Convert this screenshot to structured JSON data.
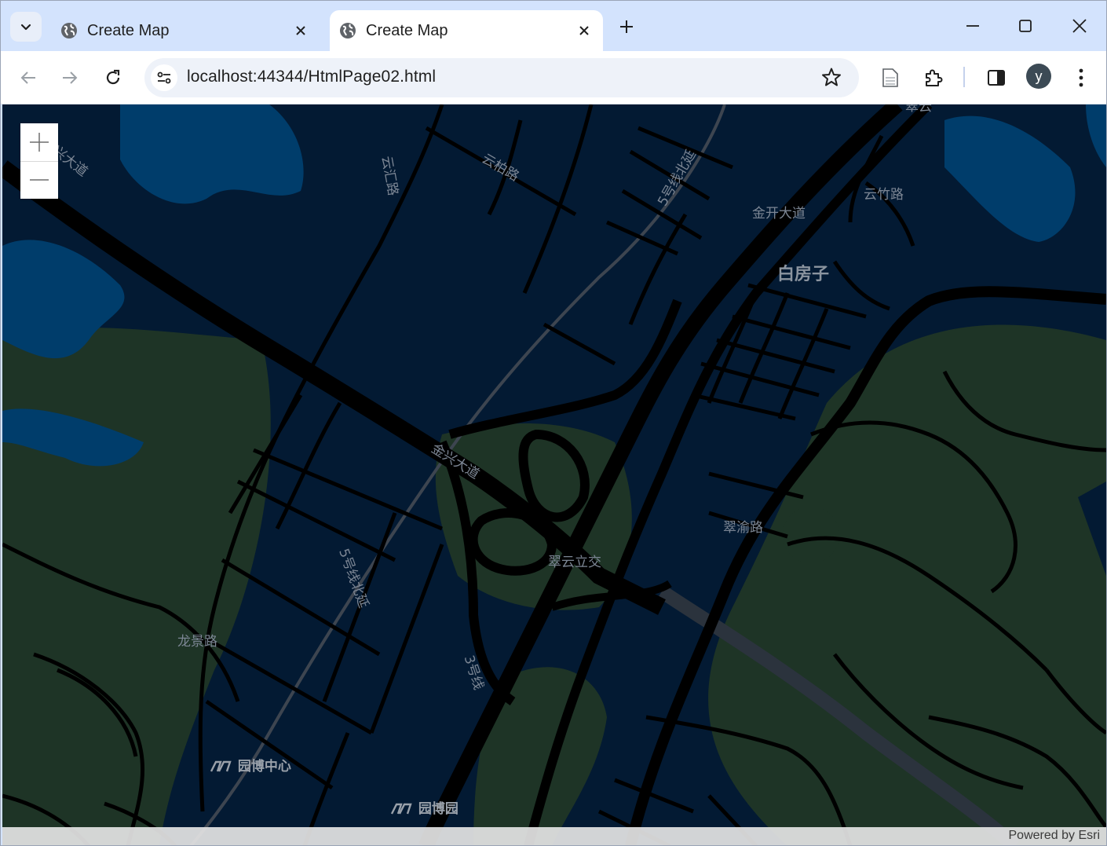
{
  "browser": {
    "tabs": [
      {
        "title": "Create Map",
        "active": false
      },
      {
        "title": "Create Map",
        "active": true
      }
    ],
    "url": "localhost:44344/HtmlPage02.html",
    "profile_initial": "y"
  },
  "map": {
    "labels": {
      "yunbai": "云柏路",
      "jinkai": "金开大道",
      "yunzhu": "云竹路",
      "baifangzi": "白房子",
      "jinxing_center": "金兴大道",
      "jinxing_left": "兴大道",
      "cuiyu": "翠渝路",
      "cuiyun_interchange": "翠云立交",
      "line5_left": "5号线北延",
      "line5_top": "5号线北延",
      "line3": "3号线",
      "longjing": "龙景路",
      "yuanbo_center": "园博中心",
      "yuanbo_yuan": "园博园",
      "top_clip": "翠云",
      "shuangfeng": "云汇路"
    },
    "attribution": "Powered by Esri",
    "colors": {
      "water": "#003d6b",
      "land": "#031a33",
      "park": "#1e3426",
      "road": "#000000",
      "rail": "#3d4550"
    }
  }
}
